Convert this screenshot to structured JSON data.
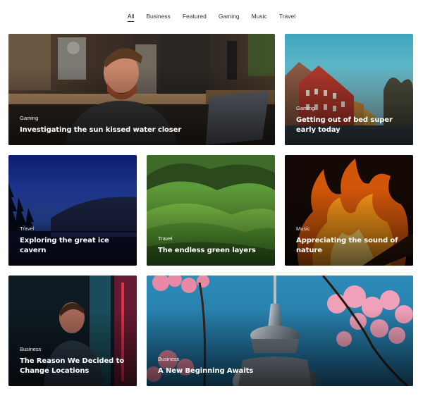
{
  "nav": {
    "items": [
      {
        "label": "All",
        "active": true
      },
      {
        "label": "Business",
        "active": false
      },
      {
        "label": "Featured",
        "active": false
      },
      {
        "label": "Gaming",
        "active": false
      },
      {
        "label": "Music",
        "active": false
      },
      {
        "label": "Travel",
        "active": false
      }
    ]
  },
  "cards": [
    {
      "category": "Gaming",
      "title": "Investigating the sun kissed water closer",
      "image": "man-in-cafe-with-laptop"
    },
    {
      "category": "Gaming",
      "title": "Getting out of bed super early today",
      "image": "red-buildings-by-canal"
    },
    {
      "category": "Travel",
      "title": "Exploring the great ice cavern",
      "image": "night-lake-with-pines"
    },
    {
      "category": "Travel",
      "title": "The endless green layers",
      "image": "green-rolling-hills"
    },
    {
      "category": "Music",
      "title": "Appreciating the sound of nature",
      "image": "campfire-flames"
    },
    {
      "category": "Business",
      "title": "The Reason We Decided to Change Locations",
      "image": "man-in-neon-light"
    },
    {
      "category": "Business",
      "title": "A New Beginning Awaits",
      "image": "tv-tower-with-cherry-blossoms"
    }
  ]
}
